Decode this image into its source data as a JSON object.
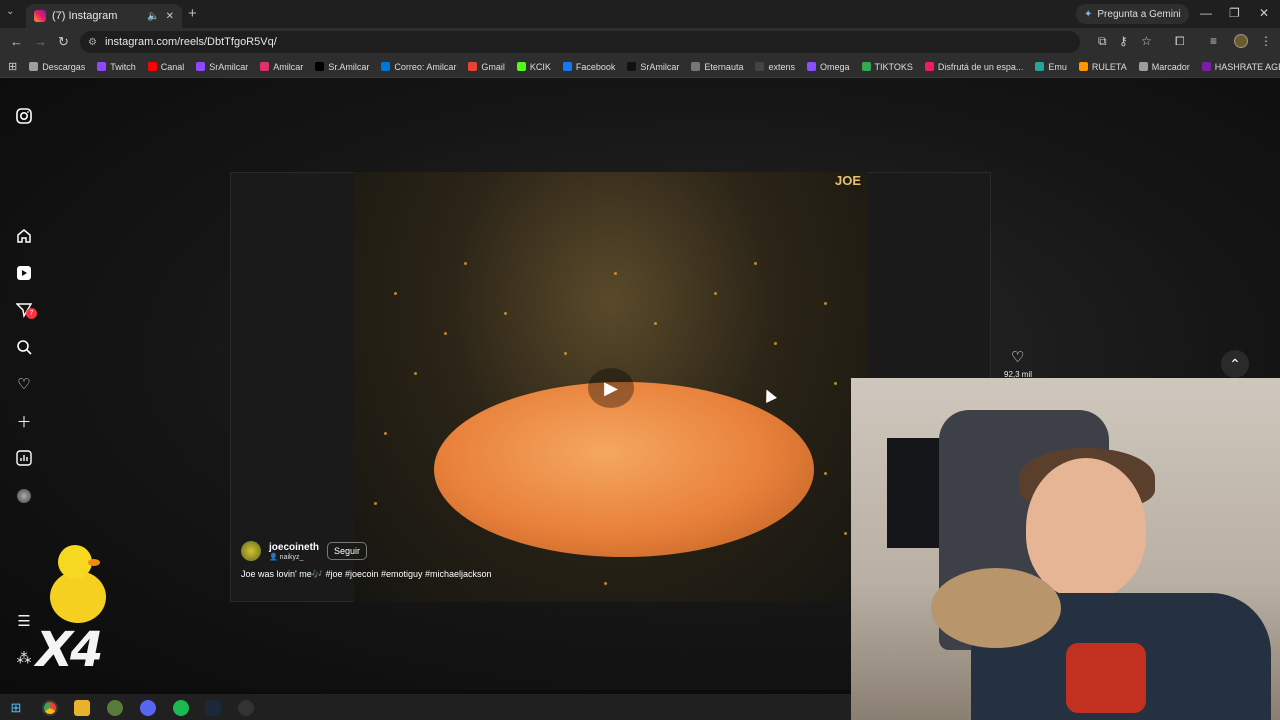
{
  "browser": {
    "tab_title": "(7) Instagram",
    "new_tab": "+",
    "gemini_label": "Pregunta a Gemini",
    "url": "instagram.com/reels/DbtTfgoR5Vq/",
    "bookmarks": [
      {
        "label": "Descargas",
        "color": "#9e9e9e"
      },
      {
        "label": "Twitch",
        "color": "#9146ff"
      },
      {
        "label": "Canal",
        "color": "#ff0000"
      },
      {
        "label": "SrAmilcar",
        "color": "#9146ff"
      },
      {
        "label": "Amilcar",
        "color": "#e1306c"
      },
      {
        "label": "Sr.Amilcar",
        "color": "#000000"
      },
      {
        "label": "Correo: Amilcar",
        "color": "#0078d4"
      },
      {
        "label": "Gmail",
        "color": "#ea4335"
      },
      {
        "label": "KCIK",
        "color": "#53fc18"
      },
      {
        "label": "Facebook",
        "color": "#1877f2"
      },
      {
        "label": "SrAmilcar",
        "color": "#111111"
      },
      {
        "label": "Eternauta",
        "color": "#777777"
      },
      {
        "label": "extens",
        "color": "#444444"
      },
      {
        "label": "Omega",
        "color": "#8a4fff"
      },
      {
        "label": "TIKTOKS",
        "color": "#34a853"
      },
      {
        "label": "Disfrutá de un espa...",
        "color": "#e91e63"
      },
      {
        "label": "Emu",
        "color": "#26a69a"
      },
      {
        "label": "RULETA",
        "color": "#ff9800"
      },
      {
        "label": "Marcador",
        "color": "#9e9e9e"
      },
      {
        "label": "HASHRATE AGENCY",
        "color": "#7b1fa2"
      }
    ]
  },
  "sidebar": {
    "notification_count": "7"
  },
  "reel": {
    "watermark": "JOE",
    "username": "joecoineth",
    "sub_user": "naikyz_",
    "follow_label": "Seguir",
    "caption": "Joe was lovin' me🎶 #joe #joecoin #emotiguy #michaeljackson",
    "likes": "92,3 mil"
  },
  "overlay": {
    "multiplier": "X4"
  },
  "colors": {
    "badge": "#ff3040",
    "page_bg": "#0c0c0c"
  }
}
